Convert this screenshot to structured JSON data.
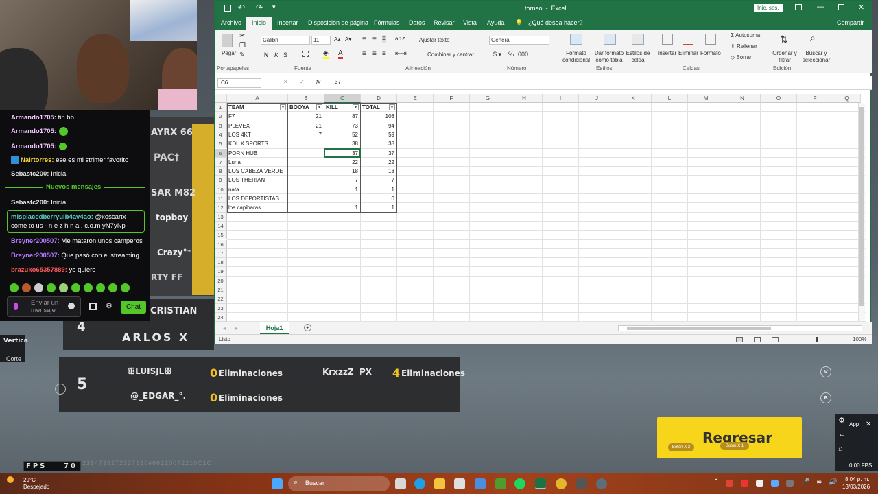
{
  "game": {
    "left_list": [
      "AYRX 66",
      "PAC†",
      "SAR M82",
      "topboy",
      "Crazy°⁺",
      "RTY FF"
    ],
    "player_cristian": "CRISTIAN",
    "rank4": "4",
    "rank4_name": "ARLOS X",
    "rank5": "5",
    "p1_name": "ꕥLUISJLꕥ",
    "p1_kills": "0",
    "p2_name": "@_EDGAR_°.",
    "p2_kills": "0",
    "p3_name": "KrxzzZ",
    "p3_tag": "PX",
    "p3_kills": "4",
    "kills_label": "Eliminaciones",
    "vertical_label": "Vertica",
    "corte_label": "Corte",
    "regresar": "Regresar",
    "btn_x2": "Botón X 2",
    "btn_x1": "Botón X 1",
    "fps_label": "FPS",
    "fps_value": "70",
    "fps_right": "0.00 FPS",
    "app_label": "App",
    "circle_v": "V",
    "circle_b": "B",
    "code_strip": "2384739272327160#66210072210C1C"
  },
  "chat": {
    "messages": [
      {
        "user": "Armando1705:",
        "text": " tin bb",
        "color": "#f4c8ff"
      },
      {
        "user": "Armando1705:",
        "text": "",
        "color": "#f4c8ff"
      },
      {
        "user": "Armando1705:",
        "text": "",
        "color": "#f4c8ff"
      },
      {
        "user": "Nairtorres:",
        "text": " ese es mi strimer favorito",
        "color": "#f5d23c"
      },
      {
        "user": "Sebastc200:",
        "text": " Inicia",
        "color": "#e0e0e0"
      },
      {
        "user": "Sebastc200:",
        "text": " Inicia",
        "color": "#e0e0e0"
      },
      {
        "user": "misplacedberryuib4av4ao:",
        "text": " @xoscartx come to us - n e z h n a . c.o.m yN7yNp",
        "color": "#59d3c4"
      },
      {
        "user": "Breyner200507:",
        "text": " Me mataron unos camperos",
        "color": "#b07cff"
      },
      {
        "user": "Breyner200507:",
        "text": " Que pasó con el streaming",
        "color": "#b07cff"
      },
      {
        "user": "brazuko65357889:",
        "text": " yo quiero",
        "color": "#ff5c5c"
      }
    ],
    "new_messages": "Nuevos mensajes",
    "input_placeholder": "Enviar un mensaje",
    "chat_button": "Chat"
  },
  "excel": {
    "title": "torneo  -  Excel",
    "signin": "Inic. ses.",
    "tabs": [
      "Archivo",
      "Inicio",
      "Insertar",
      "Disposición de página",
      "Fórmulas",
      "Datos",
      "Revisar",
      "Vista",
      "Ayuda"
    ],
    "tell_me": "¿Qué desea hacer?",
    "share": "Compartir",
    "ribbon": {
      "paste": "Pegar",
      "font_name": "Calibri",
      "font_size": "11",
      "wrap": "Ajustar texto",
      "merge": "Combinar y centrar",
      "number_format": "General",
      "cond_format": "Formato condicional",
      "table_format": "Dar formato como tabla",
      "cell_styles": "Estilos de celda",
      "insert": "Insertar",
      "delete": "Eliminar",
      "format": "Formato",
      "autosum": "Autosuma",
      "fill": "Rellenar",
      "clear": "Borrar",
      "sort": "Ordenar y filtrar",
      "find": "Buscar y seleccionar",
      "groups": [
        "Portapapeles",
        "Fuente",
        "Alineación",
        "Número",
        "Estilos",
        "Celdas",
        "Edición"
      ]
    },
    "name_box": "C6",
    "formula_value": "37",
    "columns": [
      "A",
      "B",
      "C",
      "D",
      "E",
      "F",
      "G",
      "H",
      "I",
      "J",
      "K",
      "L",
      "M",
      "N",
      "O",
      "P",
      "Q"
    ],
    "rows": [
      "1",
      "2",
      "3",
      "4",
      "5",
      "6",
      "7",
      "8",
      "9",
      "10",
      "11",
      "12",
      "13",
      "14",
      "15",
      "16",
      "17",
      "18",
      "19",
      "20",
      "21",
      "22",
      "23",
      "24"
    ],
    "headers": [
      "TEAM",
      "BOOYA",
      "KILL",
      "TOTAL"
    ],
    "data": [
      {
        "team": "F7",
        "booya": "21",
        "kill": "87",
        "total": "108"
      },
      {
        "team": "PLEVEX",
        "booya": "21",
        "kill": "73",
        "total": "94"
      },
      {
        "team": "LOS 4KT",
        "booya": "7",
        "kill": "52",
        "total": "59"
      },
      {
        "team": "KDL X SPORTS",
        "booya": "",
        "kill": "38",
        "total": "38"
      },
      {
        "team": "PORN HUB",
        "booya": "",
        "kill": "37",
        "total": "37"
      },
      {
        "team": "Luna",
        "booya": "",
        "kill": "22",
        "total": "22"
      },
      {
        "team": "LOS CABEZA VERDE",
        "booya": "",
        "kill": "18",
        "total": "18"
      },
      {
        "team": "LOS THERIAN",
        "booya": "",
        "kill": "7",
        "total": "7"
      },
      {
        "team": "nata",
        "booya": "",
        "kill": "1",
        "total": "1"
      },
      {
        "team": "LOS DEPORTISTAS",
        "booya": "",
        "kill": "",
        "total": "0"
      },
      {
        "team": "los capibaras",
        "booya": "",
        "kill": "1",
        "total": "1"
      }
    ],
    "sheet_tab": "Hoja1",
    "status": "Listo",
    "zoom": "100%"
  },
  "taskbar": {
    "temp": "29°C",
    "weather": "Despejado",
    "search": "Buscar",
    "time": "8:04 p. m.",
    "date": "13/03/2026"
  }
}
